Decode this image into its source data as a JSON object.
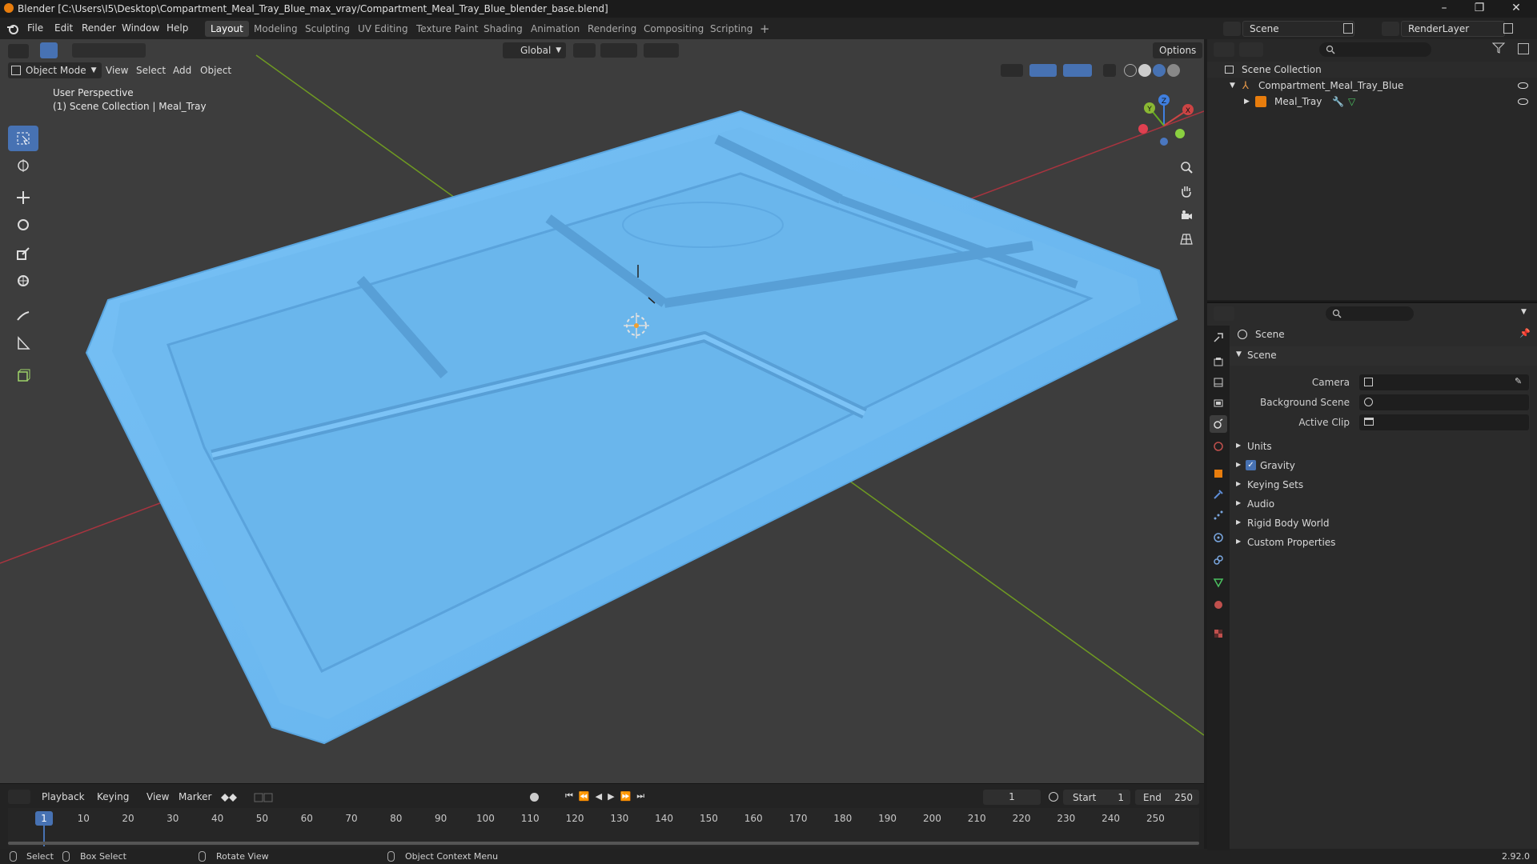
{
  "window": {
    "title": "Blender [C:\\Users\\I5\\Desktop\\Compartment_Meal_Tray_Blue_max_vray/Compartment_Meal_Tray_Blue_blender_base.blend]",
    "minimize": "–",
    "maximize": "❐",
    "close": "✕"
  },
  "menu": [
    "File",
    "Edit",
    "Render",
    "Window",
    "Help"
  ],
  "workspaces": [
    {
      "label": "Layout",
      "active": true
    },
    {
      "label": "Modeling"
    },
    {
      "label": "Sculpting"
    },
    {
      "label": "UV Editing"
    },
    {
      "label": "Texture Paint"
    },
    {
      "label": "Shading"
    },
    {
      "label": "Animation"
    },
    {
      "label": "Rendering"
    },
    {
      "label": "Compositing"
    },
    {
      "label": "Scripting"
    },
    {
      "label": "+"
    }
  ],
  "top_right": {
    "scene": "Scene",
    "render_layer": "RenderLayer"
  },
  "viewport": {
    "transform_orientation": "Global",
    "options": "Options",
    "mode": "Object Mode",
    "menus": [
      "View",
      "Select",
      "Add",
      "Object"
    ],
    "overlay_line1": "User Perspective",
    "overlay_line2": "(1) Scene Collection | Meal_Tray",
    "gizmo_axes": {
      "x": "X",
      "y": "Y",
      "z": "Z"
    },
    "colors": {
      "background": "#3d3d3d",
      "tray": "#6db8f0",
      "x_axis": "#a8343f",
      "y_axis": "#6f9a22",
      "active_tool": "#4772b3"
    }
  },
  "outliner": {
    "root": "Scene Collection",
    "collection": "Compartment_Meal_Tray_Blue",
    "object": "Meal_Tray"
  },
  "properties": {
    "header": "Scene",
    "panel": "Scene",
    "fields": {
      "camera": "Camera",
      "background_scene": "Background Scene",
      "active_clip": "Active Clip"
    },
    "subpanels": [
      "Units",
      "Gravity",
      "Keying Sets",
      "Audio",
      "Rigid Body World",
      "Custom Properties"
    ],
    "gravity_checked": true
  },
  "timeline": {
    "menus": [
      "Playback",
      "Keying",
      "View",
      "Marker"
    ],
    "current_frame": "1",
    "start_label": "Start",
    "start": "1",
    "end_label": "End",
    "end": "250",
    "ticks": [
      "1",
      "10",
      "20",
      "30",
      "40",
      "50",
      "60",
      "70",
      "80",
      "90",
      "100",
      "110",
      "120",
      "130",
      "140",
      "150",
      "160",
      "170",
      "180",
      "190",
      "200",
      "210",
      "220",
      "230",
      "240",
      "250"
    ]
  },
  "status": {
    "select": "Select",
    "box_select": "Box Select",
    "rotate_view": "Rotate View",
    "context_menu": "Object Context Menu",
    "version": "2.92.0"
  }
}
